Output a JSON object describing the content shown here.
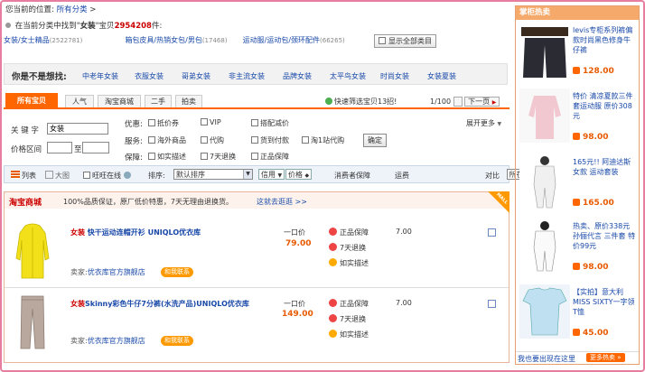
{
  "breadcrumb": {
    "prefix": "您当前的位置:",
    "link": "所有分类",
    "arrow": ">"
  },
  "found": {
    "pre": "在当前分类中找到\"",
    "keyword": "女装",
    "mid": "\"宝贝",
    "count": "2954208",
    "post": "件:"
  },
  "categories": [
    {
      "label": "女装/女士精品",
      "count": "(2522781)"
    },
    {
      "label": "箱包皮具/热销女包/男包",
      "count": "(17468)"
    },
    {
      "label": "运动服/运动包/颈环配件",
      "count": "(66265)"
    }
  ],
  "show_all_label": "显示全部类目",
  "guess": {
    "title": "你是不是想找:",
    "items": [
      "中老年女装",
      "衣服女装",
      "哥弟女装",
      "非主流女装",
      "品牌女装",
      "太平鸟女装",
      "时尚女装",
      "女装夏装"
    ]
  },
  "tabs": [
    "所有宝贝",
    "人气",
    "淘宝商城",
    "二手",
    "拍卖"
  ],
  "quick_filter": "快速筛选宝贝13招!",
  "pager": {
    "page": "1/100",
    "next": "下一页"
  },
  "filter": {
    "keyword_label": "关 键 字",
    "keyword_value": "女装",
    "price_label": "价格区间",
    "price_to": "至",
    "row1_label": "优惠:",
    "row1": [
      "抵价券",
      "VIP",
      "搭配减价"
    ],
    "row2_label": "服务:",
    "row2": [
      "海外商品",
      "代购",
      "货到付款",
      "淘1站代购"
    ],
    "row3_label": "保障:",
    "row3": [
      "如实描述",
      "7天退换",
      "正品保障"
    ],
    "confirm": "确定",
    "expand": "展开更多"
  },
  "sortbar": {
    "list": "列表",
    "bigimg": "大图",
    "wangwang": "旺旺在线",
    "sort_label": "排序:",
    "sort_value": "默认排序",
    "credit": "信用",
    "price": "价格",
    "guarantee": "消费者保障",
    "shipping": "运费",
    "location": "所在地",
    "compare": "对比"
  },
  "mall": {
    "logo": "淘宝商城",
    "slogan": "100%品质保证，原厂低价特惠，7天无理由退换货。",
    "link": "这就去逛逛 >>",
    "badge": "MALL"
  },
  "products": [
    {
      "keyword": "女装",
      "title": " 快干运动连帽开衫 UNIQLO优衣库",
      "price_label": "一口价",
      "price": "79.00",
      "seller_label": "卖家:",
      "seller": "优衣库官方旗舰店",
      "wang": "和我联系",
      "guarantees": [
        "正品保障",
        "7天退换",
        "如实描述"
      ],
      "shipping": "7.00"
    },
    {
      "keyword": "女装",
      "title": "Skinny彩色牛仔7分裤(水洗产品)UNIQLO优衣库",
      "price_label": "一口价",
      "price": "149.00",
      "seller_label": "卖家:",
      "seller": "优衣库官方旗舰店",
      "wang": "和我联系",
      "guarantees": [
        "正品保障",
        "7天退换",
        "如实描述"
      ],
      "shipping": "7.00"
    }
  ],
  "hot": {
    "title": "掌柜热卖",
    "items": [
      {
        "desc": "levis专柜系列裤偏款时尚黑色修身牛仔裤",
        "price": "128.00"
      },
      {
        "desc": "特价 清凉夏款三件套运动服 原价308元",
        "price": "98.00"
      },
      {
        "desc": "165元!! 阿迪达斯 女款 运动套装",
        "price": "165.00"
      },
      {
        "desc": "热卖、原价338元 孙俪代言 三件套 特价99元",
        "price": "98.00"
      },
      {
        "desc": "【实拍】意大利MISS SIXTY一字领T恤",
        "price": "45.00"
      }
    ],
    "footer": "我也要出现在这里",
    "more": "更多热卖"
  },
  "colors": {
    "accent": "#ff6600",
    "frame": "#e77ea0",
    "link": "#1848a8",
    "price": "#e85a00"
  }
}
